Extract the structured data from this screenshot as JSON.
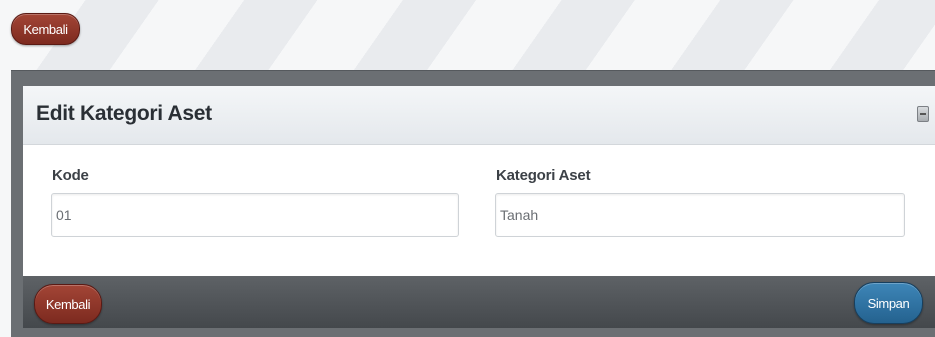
{
  "top_back_label": "Kembali",
  "panel": {
    "title": "Edit Kategori Aset"
  },
  "form": {
    "kode": {
      "label": "Kode",
      "value": "01"
    },
    "kategori": {
      "label": "Kategori Aset",
      "value": "Tanah"
    }
  },
  "footer": {
    "back_label": "Kembali",
    "save_label": "Simpan"
  },
  "colors": {
    "back_button": "#8e3527",
    "save_button": "#2f74a6",
    "footer_bar": "#4f5357"
  },
  "icons": [
    "collapse-icon"
  ]
}
